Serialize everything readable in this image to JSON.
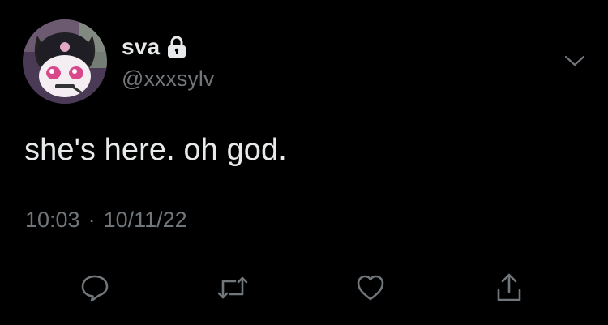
{
  "tweet": {
    "display_name": "sva",
    "handle": "@xxxsylv",
    "protected": true,
    "text": "she's here. oh god.",
    "time": "10:03",
    "separator": "·",
    "date": "10/11/22"
  },
  "icons": {
    "lock": "lock-icon",
    "more": "chevron-down-icon",
    "reply": "reply-icon",
    "retweet": "retweet-icon",
    "like": "heart-icon",
    "share": "share-icon"
  },
  "colors": {
    "background": "#000000",
    "primary_text": "#e7e9ea",
    "secondary_text": "#71767b",
    "divider": "#2f3336"
  }
}
